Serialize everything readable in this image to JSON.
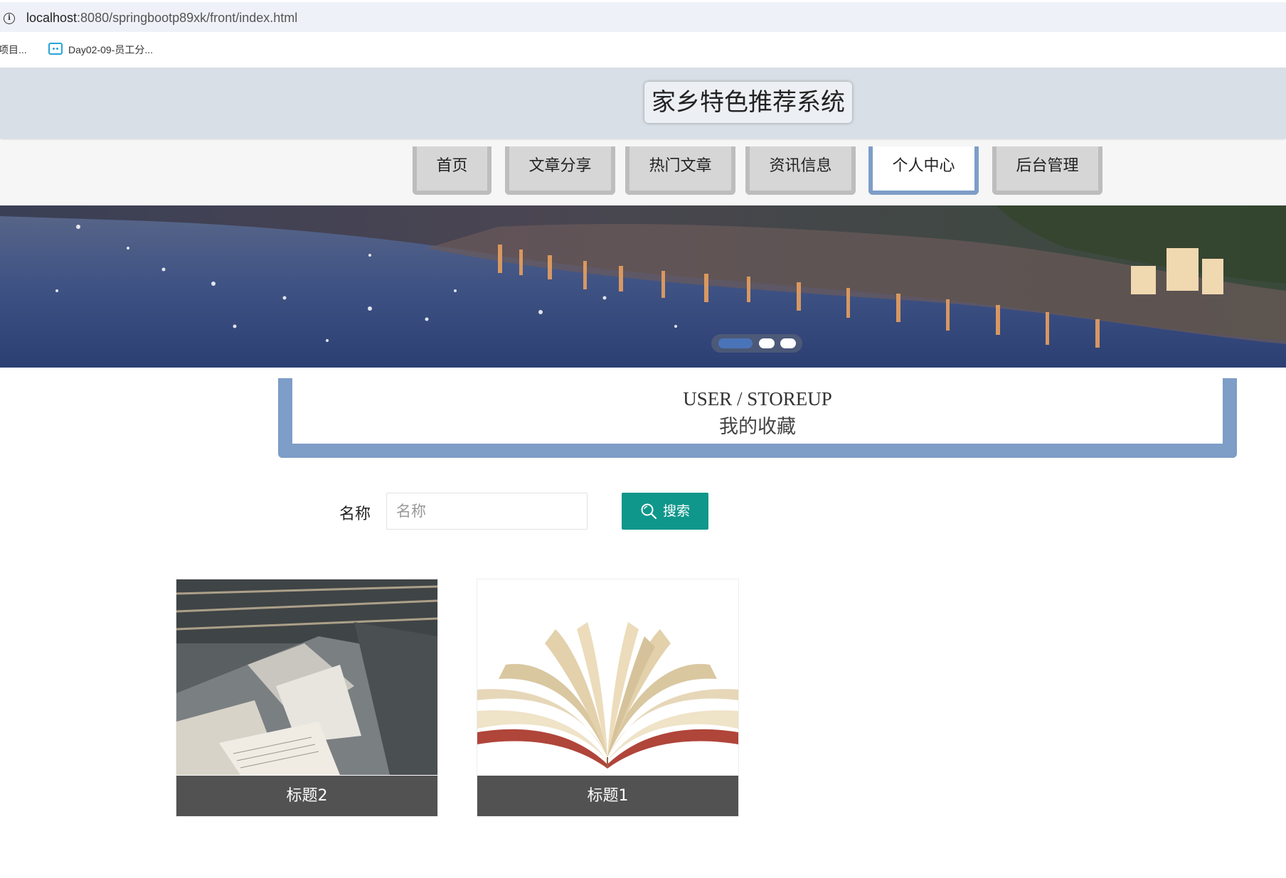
{
  "browser": {
    "url_host": "localhost",
    "url_rest": ":8080/springbootp89xk/front/index.html",
    "bookmarks": [
      {
        "label": "项目..."
      },
      {
        "label": "Day02-09-员工分..."
      }
    ]
  },
  "header": {
    "title": "家乡特色推荐系统"
  },
  "nav": {
    "items": [
      {
        "label": "首页",
        "active": false
      },
      {
        "label": "文章分享",
        "active": false
      },
      {
        "label": "热门文章",
        "active": false
      },
      {
        "label": "资讯信息",
        "active": false
      },
      {
        "label": "个人中心",
        "active": true
      },
      {
        "label": "后台管理",
        "active": false
      }
    ],
    "active_color": "#7e9dc7"
  },
  "banner": {
    "slide_count": 3,
    "active_slide": 1
  },
  "section": {
    "title_en": "USER / STOREUP",
    "title_cn": "我的收藏"
  },
  "search": {
    "label": "名称",
    "placeholder": "名称",
    "value": "",
    "button_label": "搜索",
    "button_color": "#0f978b"
  },
  "cards": [
    {
      "title": "标题2",
      "image": "bookstore-display-icon"
    },
    {
      "title": "标题1",
      "image": "open-book-icon"
    }
  ]
}
